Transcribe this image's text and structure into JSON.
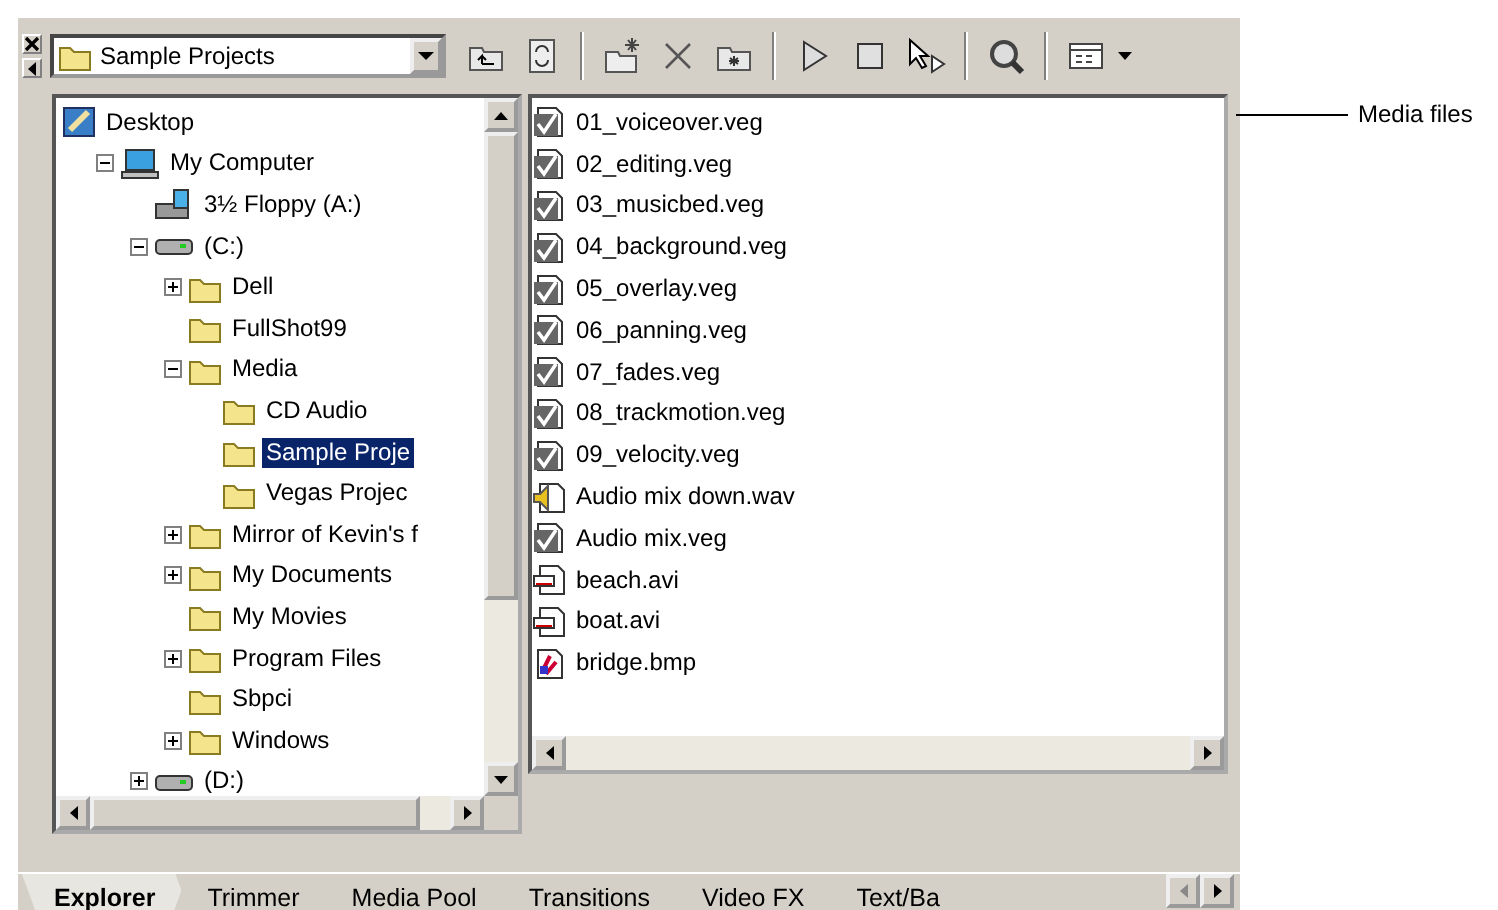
{
  "toolbar": {
    "location": "Sample Projects"
  },
  "tree": [
    {
      "label": "Desktop",
      "kind": "desktop",
      "children": [
        {
          "label": "My Computer",
          "kind": "computer",
          "expanded": true,
          "children": [
            {
              "label": "3½ Floppy (A:)",
              "kind": "floppy"
            },
            {
              "label": "(C:)",
              "kind": "drive",
              "expanded": true,
              "children": [
                {
                  "label": "Dell",
                  "kind": "folder",
                  "expanded": false
                },
                {
                  "label": "FullShot99",
                  "kind": "folder"
                },
                {
                  "label": "Media",
                  "kind": "folder",
                  "expanded": true,
                  "children": [
                    {
                      "label": "CD Audio",
                      "kind": "folder",
                      "selected": false
                    },
                    {
                      "label": "Sample Proje",
                      "kind": "folder",
                      "selected": true
                    },
                    {
                      "label": "Vegas Projec",
                      "kind": "folder",
                      "selected": false
                    }
                  ]
                },
                {
                  "label": "Mirror of Kevin's f",
                  "kind": "folder",
                  "expanded": false
                },
                {
                  "label": "My Documents",
                  "kind": "folder",
                  "expanded": false
                },
                {
                  "label": "My Movies",
                  "kind": "folder"
                },
                {
                  "label": "Program Files",
                  "kind": "folder",
                  "expanded": false
                },
                {
                  "label": "Sbpci",
                  "kind": "folder"
                },
                {
                  "label": "Windows",
                  "kind": "folder",
                  "expanded": false
                }
              ]
            },
            {
              "label": "(D:)",
              "kind": "drive",
              "expanded": false
            }
          ]
        }
      ]
    }
  ],
  "files": [
    {
      "name": "01_voiceover.veg",
      "kind": "project"
    },
    {
      "name": "02_editing.veg",
      "kind": "project"
    },
    {
      "name": "03_musicbed.veg",
      "kind": "project"
    },
    {
      "name": "04_background.veg",
      "kind": "project"
    },
    {
      "name": "05_overlay.veg",
      "kind": "project"
    },
    {
      "name": "06_panning.veg",
      "kind": "project"
    },
    {
      "name": "07_fades.veg",
      "kind": "project"
    },
    {
      "name": "08_trackmotion.veg",
      "kind": "project"
    },
    {
      "name": "09_velocity.veg",
      "kind": "project"
    },
    {
      "name": "Audio mix down.wav",
      "kind": "audio"
    },
    {
      "name": "Audio mix.veg",
      "kind": "project"
    },
    {
      "name": "beach.avi",
      "kind": "video"
    },
    {
      "name": "boat.avi",
      "kind": "video"
    },
    {
      "name": "bridge.bmp",
      "kind": "image"
    }
  ],
  "tabs": [
    {
      "label": "Explorer",
      "selected": true
    },
    {
      "label": "Trimmer",
      "selected": false
    },
    {
      "label": "Media Pool",
      "selected": false
    },
    {
      "label": "Transitions",
      "selected": false
    },
    {
      "label": "Video FX",
      "selected": false
    },
    {
      "label": "Text/Ba",
      "selected": false
    }
  ],
  "callout": "Media files"
}
